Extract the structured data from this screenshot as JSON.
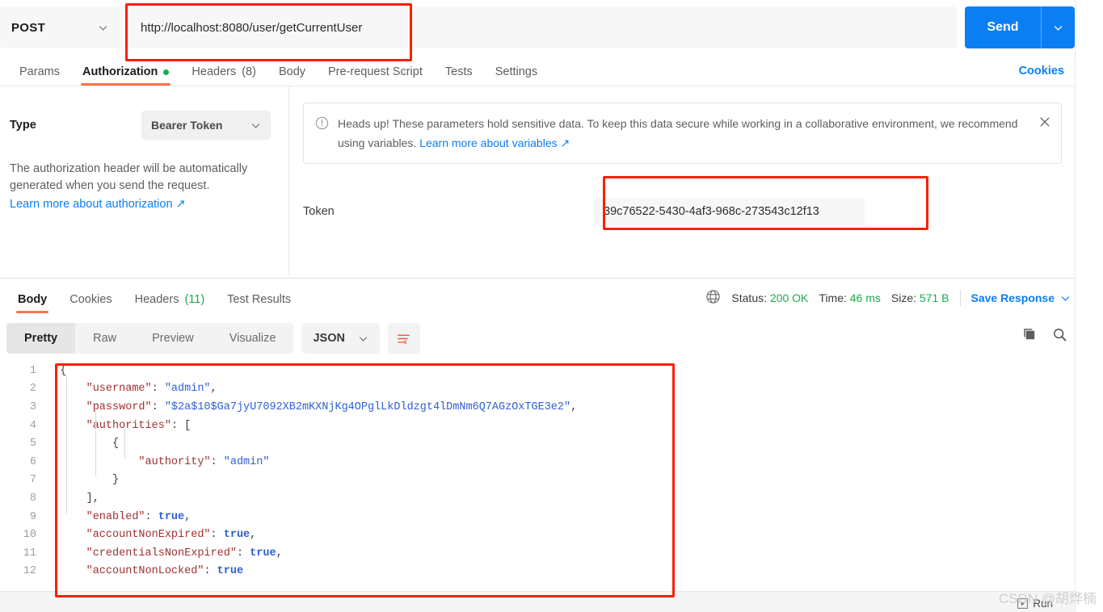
{
  "request": {
    "method": "POST",
    "url": "http://localhost:8080/user/getCurrentUser",
    "send_label": "Send",
    "tabs": [
      {
        "label": "Params",
        "active": false,
        "dot": false,
        "count": ""
      },
      {
        "label": "Authorization",
        "active": true,
        "dot": true,
        "count": ""
      },
      {
        "label": "Headers",
        "active": false,
        "dot": false,
        "count": "(8)"
      },
      {
        "label": "Body",
        "active": false,
        "dot": false,
        "count": ""
      },
      {
        "label": "Pre-request Script",
        "active": false,
        "dot": false,
        "count": ""
      },
      {
        "label": "Tests",
        "active": false,
        "dot": false,
        "count": ""
      },
      {
        "label": "Settings",
        "active": false,
        "dot": false,
        "count": ""
      }
    ],
    "cookies_link": "Cookies"
  },
  "auth": {
    "type_label": "Type",
    "type_value": "Bearer Token",
    "description": "The authorization header will be automatically generated when you send the request.",
    "learn_more": "Learn more about authorization ↗",
    "notice_text": "Heads up! These parameters hold sensitive data. To keep this data secure while working in a collaborative environment, we recommend using variables. ",
    "notice_link": "Learn more about variables ↗",
    "token_label": "Token",
    "token_value": "39c76522-5430-4af3-968c-273543c12f13"
  },
  "response": {
    "tabs": [
      {
        "label": "Body",
        "active": true,
        "count": ""
      },
      {
        "label": "Cookies",
        "active": false,
        "count": ""
      },
      {
        "label": "Headers",
        "active": false,
        "count": "(11)"
      },
      {
        "label": "Test Results",
        "active": false,
        "count": ""
      }
    ],
    "status_label": "Status:",
    "status_value": "200 OK",
    "time_label": "Time:",
    "time_value": "46 ms",
    "size_label": "Size:",
    "size_value": "571 B",
    "save_response": "Save Response",
    "format_tabs": [
      {
        "label": "Pretty",
        "active": true
      },
      {
        "label": "Raw",
        "active": false
      },
      {
        "label": "Preview",
        "active": false
      },
      {
        "label": "Visualize",
        "active": false
      }
    ],
    "language": "JSON"
  },
  "code": {
    "lines": [
      {
        "n": "1",
        "indent": 0,
        "tokens": [
          {
            "t": "{",
            "c": "p"
          }
        ]
      },
      {
        "n": "2",
        "indent": 1,
        "tokens": [
          {
            "t": "\"username\"",
            "c": "k"
          },
          {
            "t": ": ",
            "c": "p"
          },
          {
            "t": "\"admin\"",
            "c": "s"
          },
          {
            "t": ",",
            "c": "p"
          }
        ]
      },
      {
        "n": "3",
        "indent": 1,
        "tokens": [
          {
            "t": "\"password\"",
            "c": "k"
          },
          {
            "t": ": ",
            "c": "p"
          },
          {
            "t": "\"$2a$10$Ga7jyU7092XB2mKXNjKg4OPglLkDldzgt4lDmNm6Q7AGzOxTGE3e2\"",
            "c": "s"
          },
          {
            "t": ",",
            "c": "p"
          }
        ]
      },
      {
        "n": "4",
        "indent": 1,
        "tokens": [
          {
            "t": "\"authorities\"",
            "c": "k"
          },
          {
            "t": ": [",
            "c": "p"
          }
        ]
      },
      {
        "n": "5",
        "indent": 2,
        "tokens": [
          {
            "t": "{",
            "c": "p"
          }
        ]
      },
      {
        "n": "6",
        "indent": 3,
        "tokens": [
          {
            "t": "\"authority\"",
            "c": "k"
          },
          {
            "t": ": ",
            "c": "p"
          },
          {
            "t": "\"admin\"",
            "c": "s"
          }
        ]
      },
      {
        "n": "7",
        "indent": 2,
        "tokens": [
          {
            "t": "}",
            "c": "p"
          }
        ]
      },
      {
        "n": "8",
        "indent": 1,
        "tokens": [
          {
            "t": "],",
            "c": "p"
          }
        ]
      },
      {
        "n": "9",
        "indent": 1,
        "tokens": [
          {
            "t": "\"enabled\"",
            "c": "k"
          },
          {
            "t": ": ",
            "c": "p"
          },
          {
            "t": "true",
            "c": "b"
          },
          {
            "t": ",",
            "c": "p"
          }
        ]
      },
      {
        "n": "10",
        "indent": 1,
        "tokens": [
          {
            "t": "\"accountNonExpired\"",
            "c": "k"
          },
          {
            "t": ": ",
            "c": "p"
          },
          {
            "t": "true",
            "c": "b"
          },
          {
            "t": ",",
            "c": "p"
          }
        ]
      },
      {
        "n": "11",
        "indent": 1,
        "tokens": [
          {
            "t": "\"credentialsNonExpired\"",
            "c": "k"
          },
          {
            "t": ": ",
            "c": "p"
          },
          {
            "t": "true",
            "c": "b"
          },
          {
            "t": ",",
            "c": "p"
          }
        ]
      },
      {
        "n": "12",
        "indent": 1,
        "tokens": [
          {
            "t": "\"accountNonLocked\"",
            "c": "k"
          },
          {
            "t": ": ",
            "c": "p"
          },
          {
            "t": "true",
            "c": "b"
          }
        ]
      }
    ]
  },
  "footer": {
    "run_label": "Run",
    "watermark": "CSDN @胡烨楠"
  },
  "colors": {
    "accent_blue": "#0b7ef4",
    "tab_underline": "#f2754b",
    "status_green": "#1bab4c",
    "annotation_red": "#fb1f09",
    "json_key": "#a03030",
    "json_string": "#2f5fd0"
  }
}
